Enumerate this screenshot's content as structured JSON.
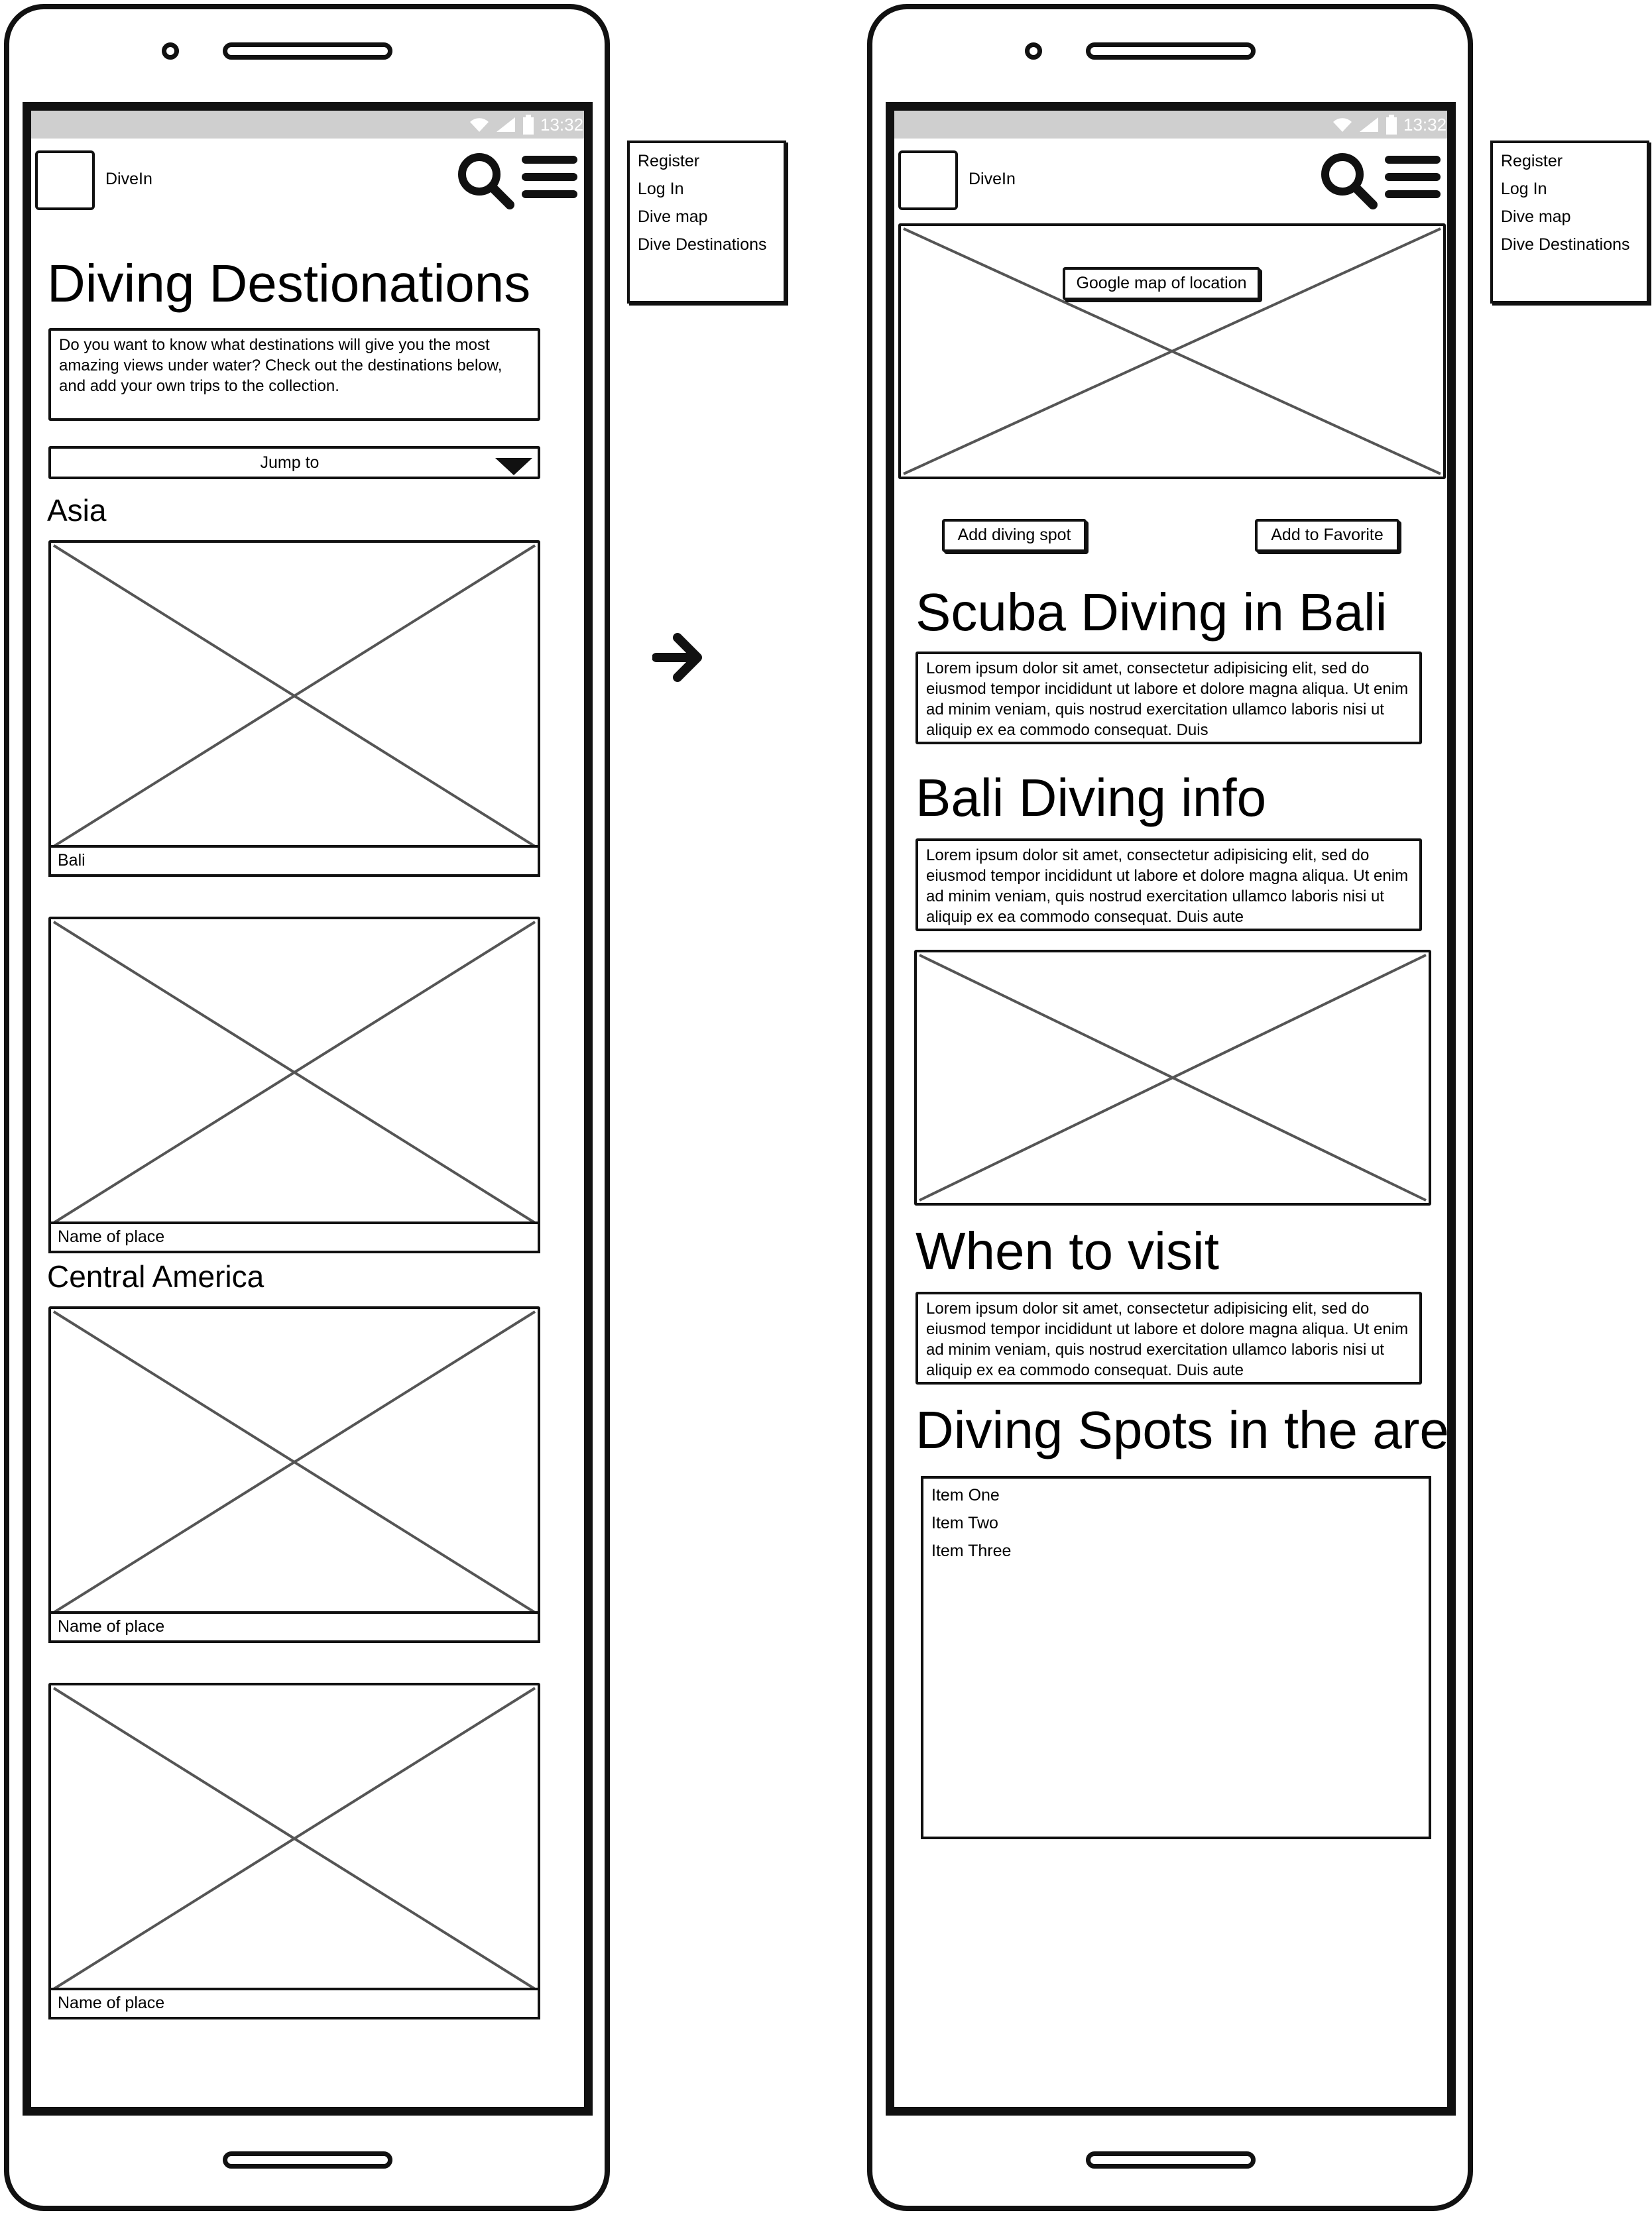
{
  "status_time": "13:32",
  "menu": [
    "Register",
    "Log In",
    "Dive map",
    "Dive Destinations"
  ],
  "left": {
    "app_name": "DiveIn",
    "title": "Diving Destionations",
    "intro": "Do you want to know what destinations will give you the most amazing views under water? Check out the destinations below, and add your own trips to the collection.",
    "jump_to": "Jump to",
    "sections": [
      {
        "heading": "Asia",
        "cards": [
          "Bali",
          "Name of place"
        ]
      },
      {
        "heading": "Central America",
        "cards": [
          "Name of place",
          "Name of place"
        ]
      }
    ]
  },
  "right": {
    "app_name": "DiveIn",
    "map_label": "Google map of location",
    "add_spot": "Add diving spot",
    "add_favorite": "Add to Favorite",
    "title": "Scuba Diving in Bali",
    "lorem1": "Lorem ipsum dolor sit amet, consectetur adipisicing elit, sed do eiusmod tempor incididunt ut labore et dolore magna aliqua. Ut enim ad minim veniam, quis nostrud exercitation ullamco laboris nisi ut aliquip ex ea commodo consequat. Duis",
    "info_heading": "Bali Diving info",
    "lorem2": "Lorem ipsum dolor sit amet, consectetur adipisicing elit, sed do eiusmod tempor incididunt ut labore et dolore magna aliqua. Ut enim ad minim veniam, quis nostrud exercitation ullamco laboris nisi ut aliquip ex ea commodo consequat. Duis aute",
    "visit_heading": "When to visit",
    "lorem3": "Lorem ipsum dolor sit amet, consectetur adipisicing elit, sed do eiusmod tempor incididunt ut labore et dolore magna aliqua. Ut enim ad minim veniam, quis nostrud exercitation ullamco laboris nisi ut aliquip ex ea commodo consequat. Duis aute",
    "spots_heading": "Diving Spots in the area",
    "spots": [
      "Item One",
      "Item Two",
      "Item Three"
    ]
  }
}
